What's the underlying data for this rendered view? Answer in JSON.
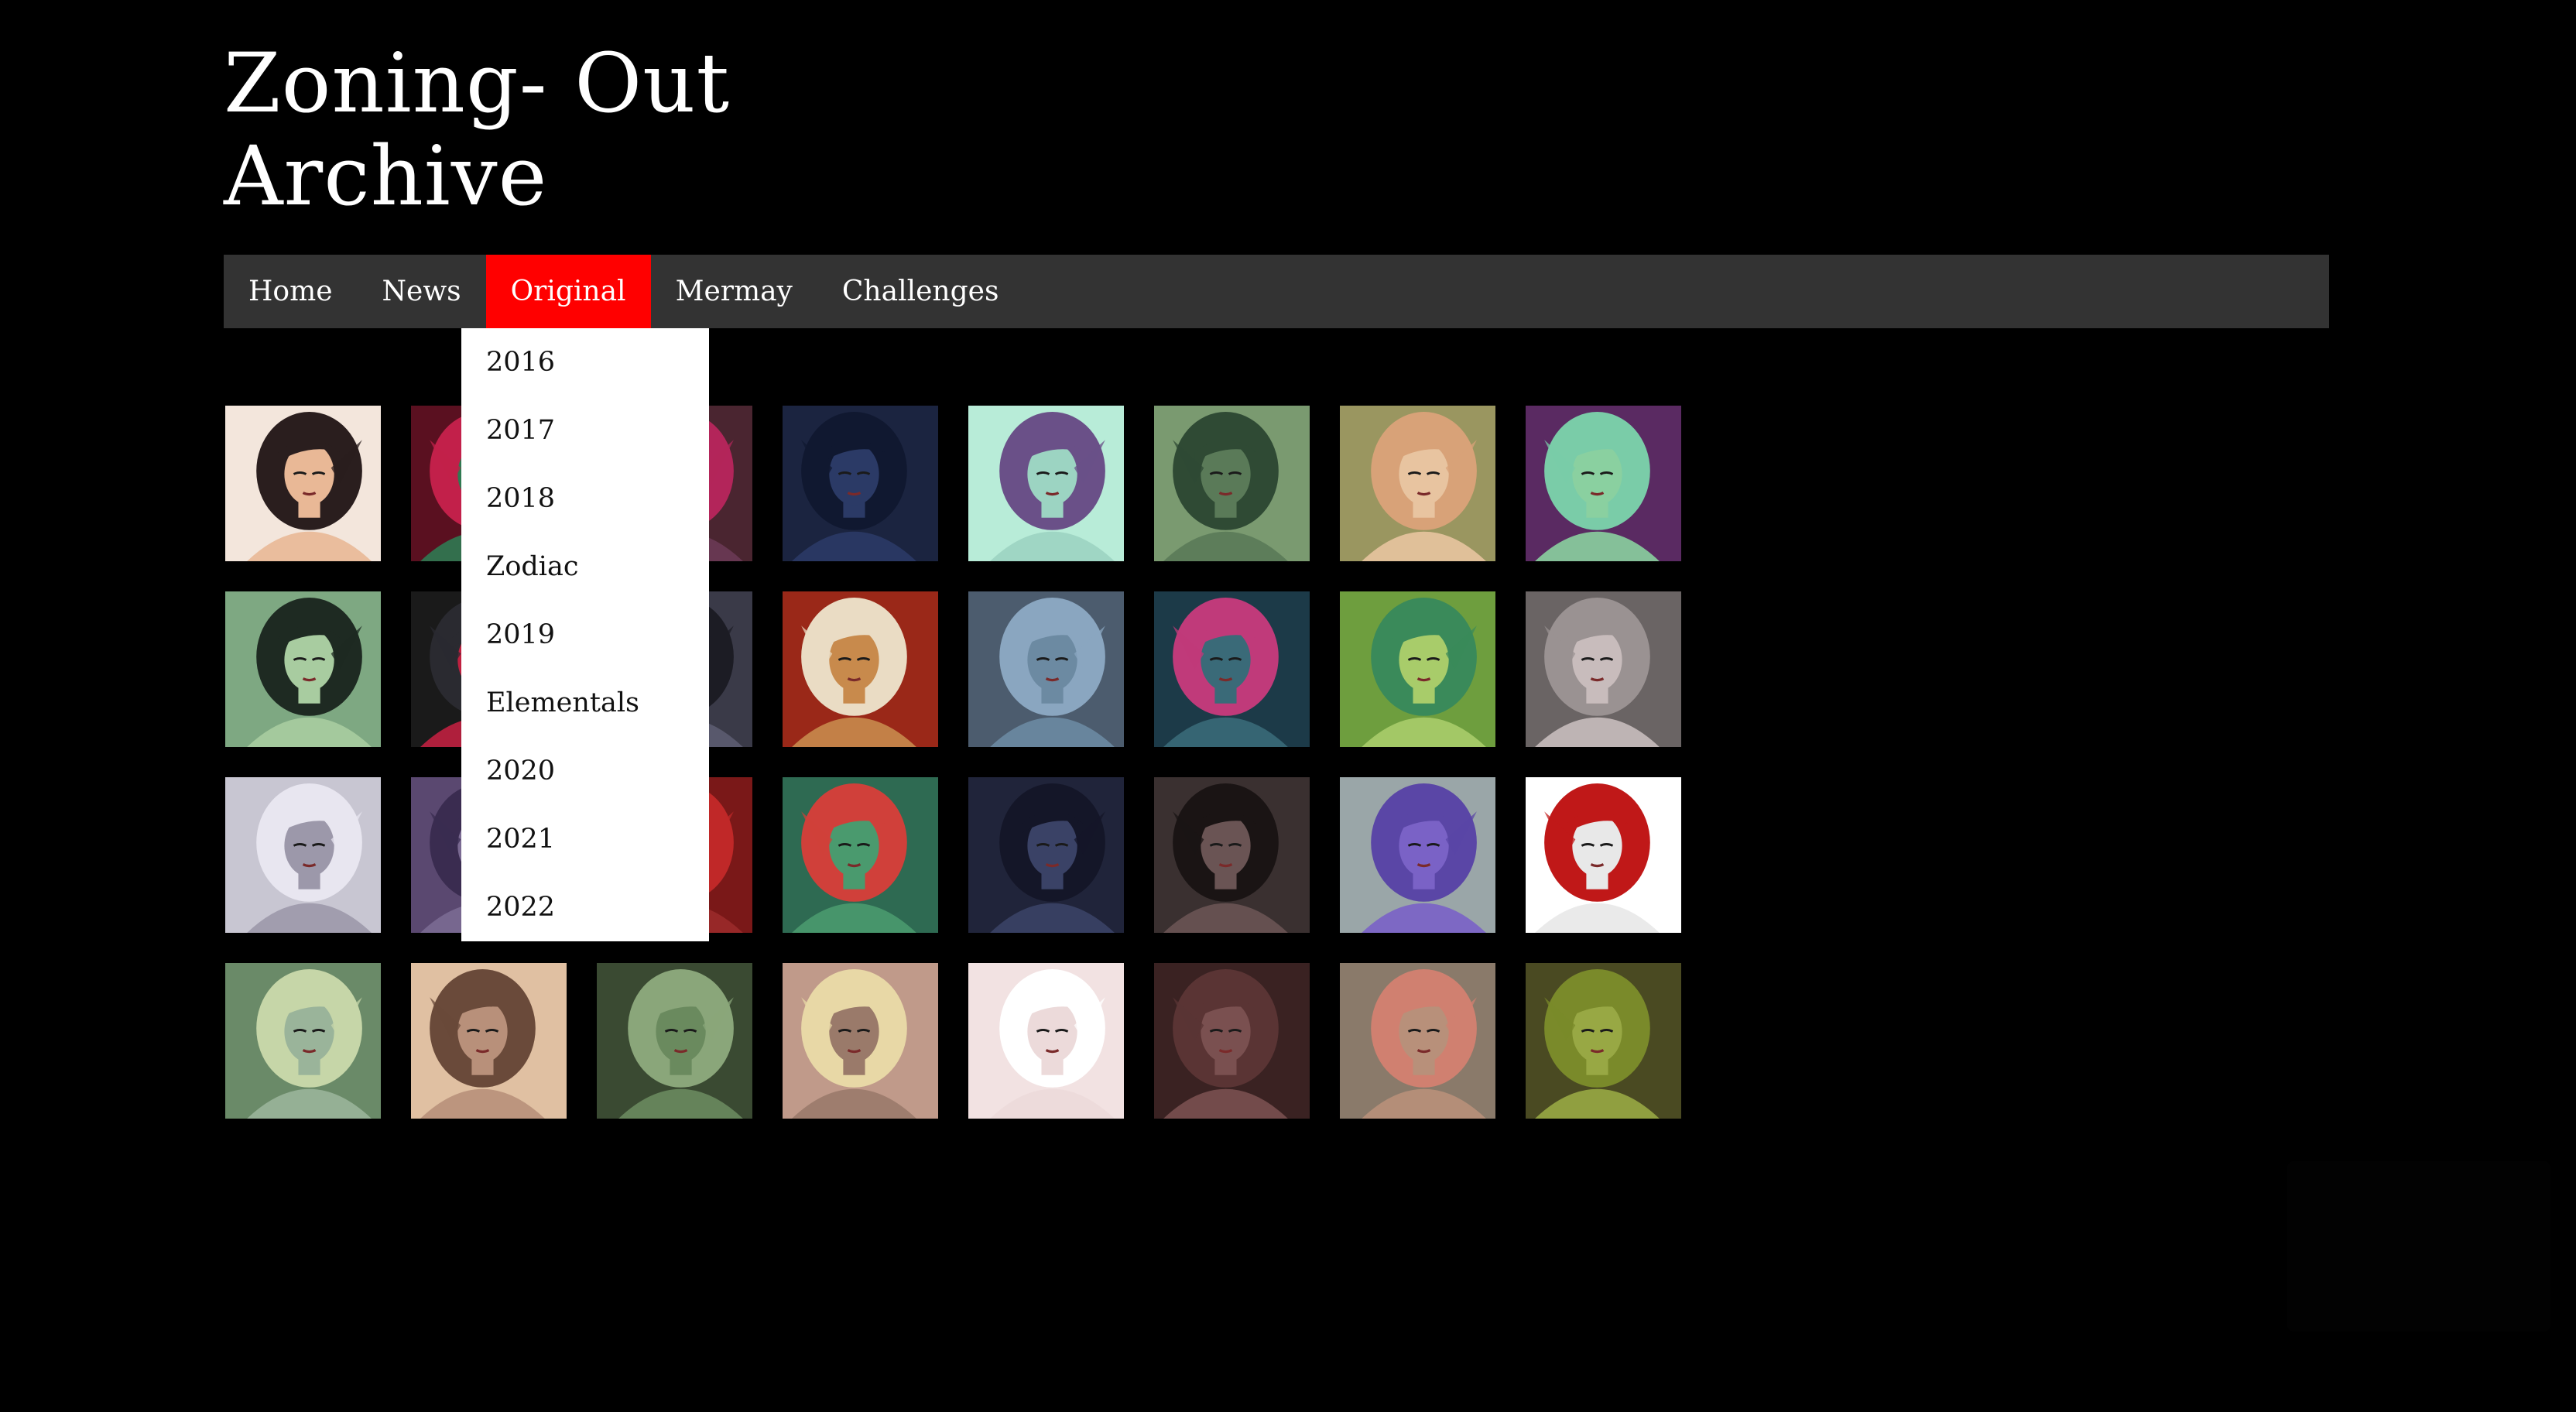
{
  "site": {
    "title_line1": "Zoning- Out",
    "title_line2": "Archive"
  },
  "nav": {
    "items": [
      "Home",
      "News",
      "Original",
      "Mermay",
      "Challenges"
    ],
    "active": "Original",
    "active_color": "#ff0000",
    "bar_color": "#333333"
  },
  "dropdown": {
    "items": [
      "2016",
      "2017",
      "2018",
      "Zodiac",
      "2019",
      "Elementals",
      "2020",
      "2021",
      "2022"
    ]
  },
  "gallery": {
    "thumbnails": [
      {
        "bg": "#f3e6dc",
        "hair": "#2a1e1e",
        "skin": "#e9b896",
        "label": "portrait-1"
      },
      {
        "bg": "#5a1020",
        "hair": "#c2204a",
        "skin": "#2f7a52",
        "label": "portrait-2"
      },
      {
        "bg": "#4a2530",
        "hair": "#b3255a",
        "skin": "#6a3a55",
        "label": "portrait-3"
      },
      {
        "bg": "#1b2440",
        "hair": "#101830",
        "skin": "#2b3a66",
        "label": "portrait-4"
      },
      {
        "bg": "#b8ecd8",
        "hair": "#6a5088",
        "skin": "#9cd4c2",
        "label": "portrait-5"
      },
      {
        "bg": "#7a9a70",
        "hair": "#2f4a34",
        "skin": "#5a7a58",
        "label": "portrait-6"
      },
      {
        "bg": "#9a9660",
        "hair": "#d8a278",
        "skin": "#e8c4a0",
        "label": "portrait-7"
      },
      {
        "bg": "#5a2a62",
        "hair": "#7acca8",
        "skin": "#8ad0a0",
        "label": "portrait-8"
      },
      {
        "bg": "#7ea882",
        "hair": "#1e2a22",
        "skin": "#a8cca0",
        "label": "portrait-9"
      },
      {
        "bg": "#1a1a1a",
        "hair": "#2a2a30",
        "skin": "#c02040",
        "label": "portrait-10"
      },
      {
        "bg": "#3a3a48",
        "hair": "#1c1c24",
        "skin": "#5c5c70",
        "label": "portrait-11"
      },
      {
        "bg": "#9a2818",
        "hair": "#eadcc4",
        "skin": "#c88a4c",
        "label": "portrait-12"
      },
      {
        "bg": "#4c5c6e",
        "hair": "#8aa6c0",
        "skin": "#6c8aa2",
        "label": "portrait-13"
      },
      {
        "bg": "#1c3a48",
        "hair": "#c03a7a",
        "skin": "#3a6a78",
        "label": "portrait-14"
      },
      {
        "bg": "#6e9e3e",
        "hair": "#3a8a5a",
        "skin": "#a8cc6a",
        "label": "portrait-15"
      },
      {
        "bg": "#6a6464",
        "hair": "#9a9292",
        "skin": "#c8bcbc",
        "label": "portrait-16"
      },
      {
        "bg": "#c8c6d2",
        "hair": "#e8e6f0",
        "skin": "#9c98aa",
        "label": "portrait-17"
      },
      {
        "bg": "#5a4870",
        "hair": "#3a2c50",
        "skin": "#7a6a92",
        "label": "portrait-18"
      },
      {
        "bg": "#7a1818",
        "hair": "#c02828",
        "skin": "#9a2a2a",
        "label": "portrait-19"
      },
      {
        "bg": "#2e6a52",
        "hair": "#d0403a",
        "skin": "#4a9a6e",
        "label": "portrait-20"
      },
      {
        "bg": "#20243a",
        "hair": "#141628",
        "skin": "#3a4266",
        "label": "portrait-21"
      },
      {
        "bg": "#3a3030",
        "hair": "#1a1414",
        "skin": "#6a5454",
        "label": "portrait-22"
      },
      {
        "bg": "#9aa6a8",
        "hair": "#5a46a6",
        "skin": "#7a62c6",
        "label": "portrait-23"
      },
      {
        "bg": "#ffffff",
        "hair": "#c01818",
        "skin": "#e8e8e8",
        "label": "portrait-24"
      },
      {
        "bg": "#6a8a68",
        "hair": "#c6d6a8",
        "skin": "#9ab49a",
        "label": "portrait-25"
      },
      {
        "bg": "#e0c0a2",
        "hair": "#6a4a3a",
        "skin": "#b8907a",
        "label": "portrait-26"
      },
      {
        "bg": "#3a4a32",
        "hair": "#8aa67a",
        "skin": "#6a8a5e",
        "label": "portrait-27"
      },
      {
        "bg": "#c09a8a",
        "hair": "#e8d8a6",
        "skin": "#9a7a6a",
        "label": "portrait-28"
      },
      {
        "bg": "#f2e2e2",
        "hair": "#ffffff",
        "skin": "#ecdada",
        "label": "portrait-29"
      },
      {
        "bg": "#3a2222",
        "hair": "#5a3434",
        "skin": "#7a5050",
        "label": "portrait-30"
      },
      {
        "bg": "#8a7a6a",
        "hair": "#d08070",
        "skin": "#b8907a",
        "label": "portrait-31"
      },
      {
        "bg": "#4a4a22",
        "hair": "#7a8a2a",
        "skin": "#98a844",
        "label": "portrait-32"
      }
    ]
  }
}
